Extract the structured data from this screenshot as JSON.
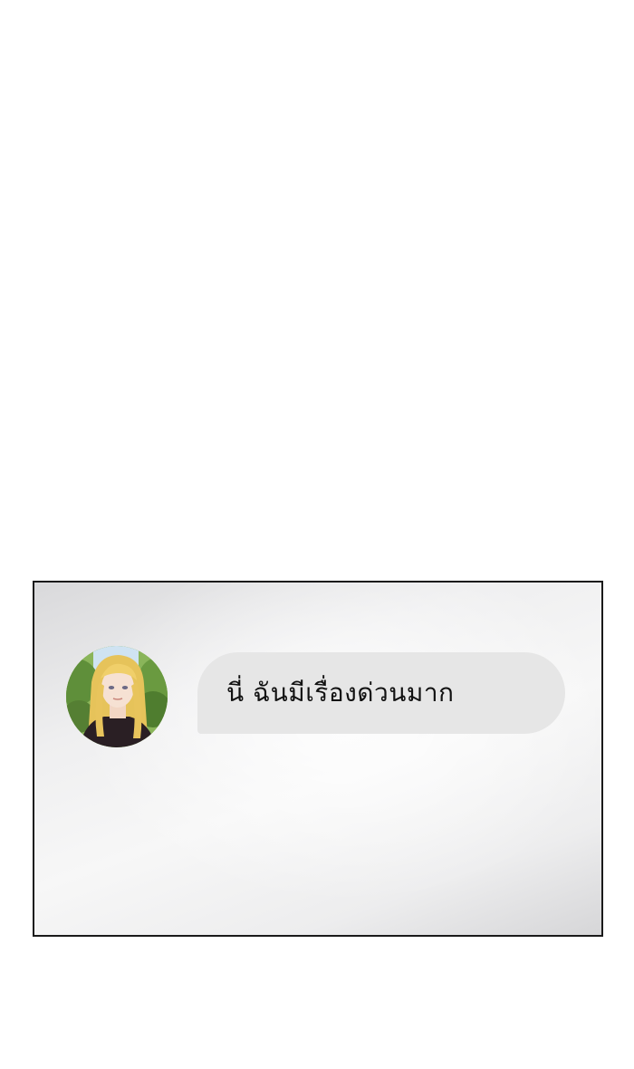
{
  "chat": {
    "sender": {
      "avatar_icon": "profile-photo-blonde-woman"
    },
    "message": {
      "text": "นี่ ฉันมีเรื่องด่วนมาก"
    }
  },
  "colors": {
    "bubble_background": "#e6e6e6",
    "panel_border": "#1a1a1a",
    "page_background": "#ffffff"
  }
}
